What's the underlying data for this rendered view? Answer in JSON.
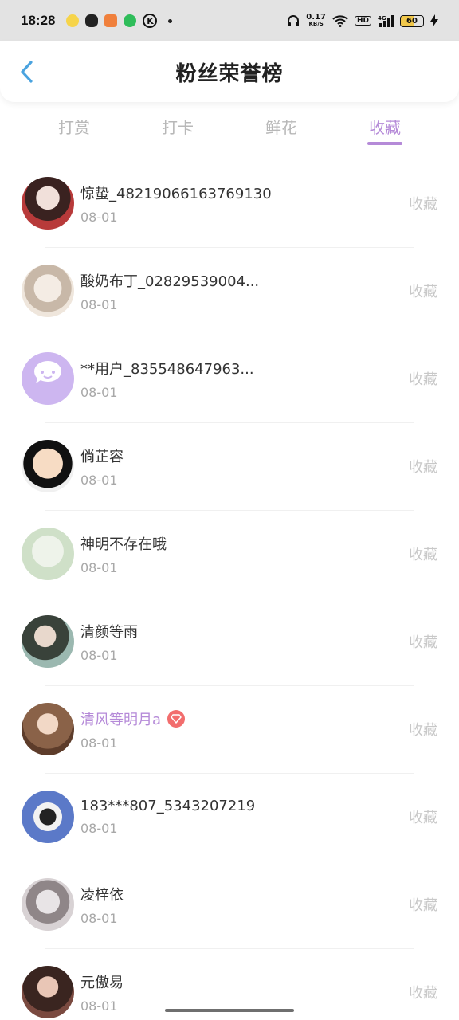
{
  "status_bar": {
    "time": "18:28",
    "net_speed": "0.17",
    "net_unit": "KB/S",
    "hd_label": "HD",
    "battery_level": "60",
    "battery_color": "#f1c84b"
  },
  "header": {
    "title": "粉丝荣誉榜",
    "back_icon": "chevron-left-icon"
  },
  "tabs": [
    {
      "label": "打赏",
      "active": false
    },
    {
      "label": "打卡",
      "active": false
    },
    {
      "label": "鲜花",
      "active": false
    },
    {
      "label": "收藏",
      "active": true
    }
  ],
  "colors": {
    "accent": "#b58ad8",
    "back_arrow": "#4aa3df",
    "vip_badge": "#f26d6d"
  },
  "fans": [
    {
      "name": "惊蛰_48219066163769130",
      "date": "08-01",
      "action": "收藏",
      "vip": false
    },
    {
      "name": "酸奶布丁_02829539004...",
      "date": "08-01",
      "action": "收藏",
      "vip": false
    },
    {
      "name": "**用户_835548647963...",
      "date": "08-01",
      "action": "收藏",
      "vip": false
    },
    {
      "name": "倘芷容",
      "date": "08-01",
      "action": "收藏",
      "vip": false
    },
    {
      "name": "神明不存在哦",
      "date": "08-01",
      "action": "收藏",
      "vip": false
    },
    {
      "name": "清颜等雨",
      "date": "08-01",
      "action": "收藏",
      "vip": false
    },
    {
      "name": "清风等明月a",
      "date": "08-01",
      "action": "收藏",
      "vip": true
    },
    {
      "name": "183***807_5343207219",
      "date": "08-01",
      "action": "收藏",
      "vip": false
    },
    {
      "name": "凌梓依",
      "date": "08-01",
      "action": "收藏",
      "vip": false
    },
    {
      "name": "元傲易",
      "date": "08-01",
      "action": "收藏",
      "vip": false
    }
  ]
}
